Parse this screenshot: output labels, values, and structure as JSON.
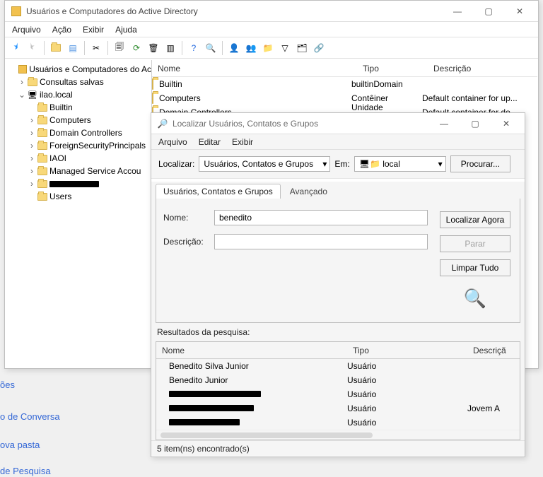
{
  "main_window": {
    "title": "Usuários e Computadores do Active Directory",
    "menu": {
      "arquivo": "Arquivo",
      "acao": "Ação",
      "exibir": "Exibir",
      "ajuda": "Ajuda"
    }
  },
  "tree": {
    "root": "Usuários e Computadores do Ac",
    "saved": "Consultas salvas",
    "domain": "ilao.local",
    "items": [
      "Builtin",
      "Computers",
      "Domain Controllers",
      "ForeignSecurityPrincipals",
      "IAOI",
      "Managed Service Accou",
      "",
      "Users"
    ]
  },
  "list": {
    "headers": {
      "name": "Nome",
      "type": "Tipo",
      "desc": "Descrição"
    },
    "rows": [
      {
        "name": "Builtin",
        "type": "builtinDomain",
        "desc": ""
      },
      {
        "name": "Computers",
        "type": "Contêiner",
        "desc": "Default container for up..."
      },
      {
        "name": "Domain Controllers",
        "type": "Unidade Orga...",
        "desc": "Default container for do..."
      }
    ]
  },
  "find": {
    "title": "Localizar Usuários, Contatos e Grupos",
    "menu": {
      "arquivo": "Arquivo",
      "editar": "Editar",
      "exibir": "Exibir"
    },
    "localizar_label": "Localizar:",
    "localizar_value": "Usuários, Contatos e Grupos",
    "em_label": "Em:",
    "em_value": "local",
    "procurar": "Procurar...",
    "tab_main": "Usuários, Contatos e Grupos",
    "tab_adv": "Avançado",
    "nome_label": "Nome:",
    "nome_value": "benedito",
    "desc_label": "Descrição:",
    "desc_value": "",
    "btn_find": "Localizar Agora",
    "btn_stop": "Parar",
    "btn_clear": "Limpar Tudo",
    "results_label": "Resultados da pesquisa:",
    "results_headers": {
      "name": "Nome",
      "type": "Tipo",
      "desc": "Descriçã"
    },
    "results": [
      {
        "name": "Benedito Silva Junior",
        "type": "Usuário",
        "desc": "",
        "redact": false
      },
      {
        "name": "Benedito Junior",
        "type": "Usuário",
        "desc": "",
        "redact": false
      },
      {
        "name": "",
        "type": "Usuário",
        "desc": "",
        "redact": true,
        "w": 130
      },
      {
        "name": "",
        "type": "Usuário",
        "desc": "Jovem A",
        "redact": true,
        "w": 120
      },
      {
        "name": "",
        "type": "Usuário",
        "desc": "",
        "redact": true,
        "w": 100
      }
    ],
    "status": "5 item(ns) encontrado(s)"
  },
  "bg": {
    "oes": "ões",
    "conversa": "o de Conversa",
    "pasta": "ova pasta",
    "pesquisa": "de Pesquisa"
  }
}
